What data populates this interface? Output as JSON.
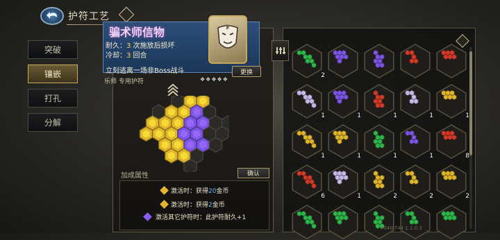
{
  "header": {
    "title": "护符工艺"
  },
  "menu": [
    {
      "label": "突破",
      "active": false
    },
    {
      "label": "镶嵌",
      "active": true
    },
    {
      "label": "打孔",
      "active": false
    },
    {
      "label": "分解",
      "active": false
    }
  ],
  "charm": {
    "name": "骗术师信物",
    "durability_label": "耐久：",
    "durability_value": "3",
    "durability_suffix": " 次施放后损坏",
    "cooldown_label": "冷却：",
    "cooldown_value": "3",
    "cooldown_suffix": " 回合",
    "effect": "立刻逃离一场非Boss战斗",
    "swap_label": "更换",
    "exclusive": "乐师 专用护符",
    "stars": "❖❖❖❖❖"
  },
  "attributes": {
    "title": "加成属性",
    "confirm_label": "确认",
    "rows": [
      {
        "prefix": "激活时：获得",
        "value": "20",
        "suffix": "金币",
        "color": "#e3b52e"
      },
      {
        "prefix": "激活时：获得",
        "value": "2",
        "suffix": "金币",
        "color": "#e3b52e"
      },
      {
        "prefix": "激活其它护符时：此护符耐久+1",
        "value": "",
        "suffix": "",
        "color": "#8a5cf0"
      }
    ]
  },
  "board": {
    "cells": [
      {
        "c": -1,
        "r": -3,
        "color": "empty"
      },
      {
        "c": 0,
        "r": -3,
        "color": "gold"
      },
      {
        "c": 1,
        "r": -3,
        "color": "gold"
      },
      {
        "c": -2,
        "r": -2,
        "color": "empty"
      },
      {
        "c": -1,
        "r": -2,
        "color": "gold"
      },
      {
        "c": 0,
        "r": -2,
        "color": "gold"
      },
      {
        "c": 1,
        "r": -2,
        "color": "purple"
      },
      {
        "c": 2,
        "r": -2,
        "color": "empty"
      },
      {
        "c": -3,
        "r": -1,
        "color": "gold"
      },
      {
        "c": -2,
        "r": -1,
        "color": "gold"
      },
      {
        "c": -1,
        "r": -1,
        "color": "gold"
      },
      {
        "c": 0,
        "r": -1,
        "color": "purple"
      },
      {
        "c": 1,
        "r": -1,
        "color": "purple"
      },
      {
        "c": 2,
        "r": -1,
        "color": "empty"
      },
      {
        "c": 3,
        "r": -1,
        "color": "empty"
      },
      {
        "c": -3,
        "r": 0,
        "color": "gold"
      },
      {
        "c": -2,
        "r": 0,
        "color": "gold"
      },
      {
        "c": -1,
        "r": 0,
        "color": "gold"
      },
      {
        "c": 0,
        "r": 0,
        "color": "purple"
      },
      {
        "c": 1,
        "r": 0,
        "color": "purple"
      },
      {
        "c": 2,
        "r": 0,
        "color": "empty"
      },
      {
        "c": 3,
        "r": 0,
        "color": "empty"
      },
      {
        "c": -2,
        "r": 1,
        "color": "gold"
      },
      {
        "c": -1,
        "r": 1,
        "color": "gold"
      },
      {
        "c": 0,
        "r": 1,
        "color": "purple"
      },
      {
        "c": 1,
        "r": 1,
        "color": "purple"
      },
      {
        "c": 2,
        "r": 1,
        "color": "empty"
      },
      {
        "c": -1,
        "r": 2,
        "color": "gold"
      },
      {
        "c": 0,
        "r": 2,
        "color": "gold"
      },
      {
        "c": 1,
        "r": 2,
        "color": "empty"
      },
      {
        "c": 0,
        "r": 3,
        "color": "empty"
      }
    ]
  },
  "colors": {
    "gold": "#e0b52c",
    "purple": "#7d55e6",
    "green": "#2fb64a",
    "red": "#d23a2a",
    "lavender": "#c7b8e8",
    "empty": "#2b2a27"
  },
  "inventory": {
    "slots": [
      {
        "color": "green",
        "count": "2"
      },
      {
        "color": "purple",
        "count": ""
      },
      {
        "color": "purple",
        "count": ""
      },
      {
        "color": "red",
        "count": ""
      },
      {
        "color": "red",
        "count": ""
      },
      {
        "color": "lavender",
        "count": "1"
      },
      {
        "color": "purple",
        "count": "1"
      },
      {
        "color": "red",
        "count": "1"
      },
      {
        "color": "lavender",
        "count": "1"
      },
      {
        "color": "gold",
        "count": "1"
      },
      {
        "color": "gold",
        "count": "1"
      },
      {
        "color": "gold",
        "count": "1"
      },
      {
        "color": "green",
        "count": "1"
      },
      {
        "color": "purple",
        "count": "1"
      },
      {
        "color": "red",
        "count": "8"
      },
      {
        "color": "red",
        "count": "6"
      },
      {
        "color": "lavender",
        "count": "1"
      },
      {
        "color": "gold",
        "count": "2"
      },
      {
        "color": "gold",
        "count": "2"
      },
      {
        "color": "gold",
        "count": "2"
      },
      {
        "color": "green",
        "count": ""
      },
      {
        "color": "green",
        "count": ""
      },
      {
        "color": "green",
        "count": ""
      },
      {
        "color": "green",
        "count": ""
      },
      {
        "color": "green",
        "count": ""
      }
    ]
  },
  "version": "P04I0744 1.1.0.3"
}
